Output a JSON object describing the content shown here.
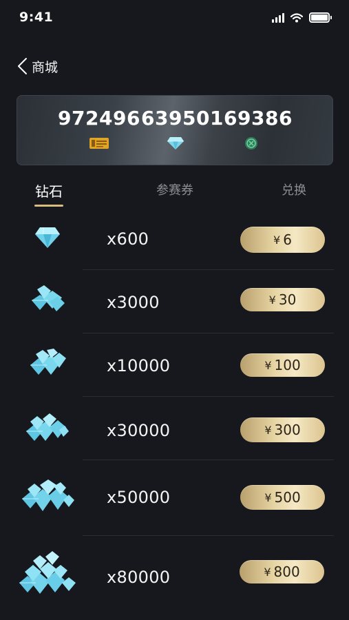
{
  "status": {
    "time": "9:41"
  },
  "nav": {
    "title": "商城"
  },
  "balances": [
    {
      "value": "972496",
      "icon": "ticket-icon"
    },
    {
      "value": "63950",
      "icon": "diamond-icon"
    },
    {
      "value": "169386",
      "icon": "coin-icon"
    }
  ],
  "tabs": [
    {
      "label": "钻石",
      "active": true
    },
    {
      "label": "参赛券",
      "active": false
    },
    {
      "label": "兑换",
      "active": false
    }
  ],
  "items": [
    {
      "amount": "x600",
      "currency": "¥",
      "price": "6",
      "icon": "diamond-single-icon"
    },
    {
      "amount": "x3000",
      "currency": "¥",
      "price": "30",
      "icon": "diamond-pile-small-icon"
    },
    {
      "amount": "x10000",
      "currency": "¥",
      "price": "100",
      "icon": "diamond-pile-medium-icon"
    },
    {
      "amount": "x30000",
      "currency": "¥",
      "price": "300",
      "icon": "diamond-pile-large-icon"
    },
    {
      "amount": "x50000",
      "currency": "¥",
      "price": "500",
      "icon": "diamond-heap-icon"
    },
    {
      "amount": "x80000",
      "currency": "¥",
      "price": "800",
      "icon": "diamond-mountain-icon"
    }
  ],
  "colors": {
    "background": "#17181d",
    "gold_accent": "#d8bd7e",
    "diamond": "#8fe3f4"
  }
}
